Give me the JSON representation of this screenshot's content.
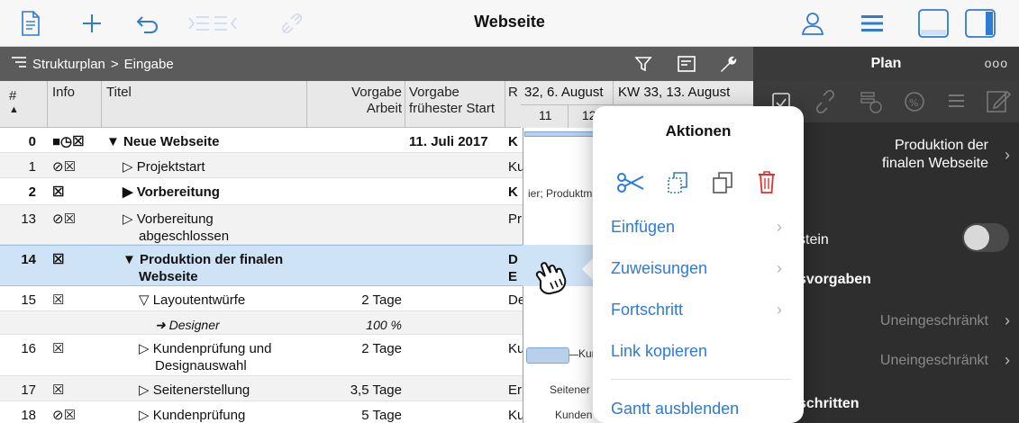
{
  "toolbar": {
    "title": "Webseite"
  },
  "breadcrumb": {
    "root": "Strukturplan",
    "separator": ">",
    "current": "Eingabe"
  },
  "inspector": {
    "title": "Plan",
    "more": "ooo",
    "task_name_line1": "Produktion der",
    "task_name_line2": "finalen Webseite",
    "milestone_label": "stein",
    "constraints_header": "svorgaben",
    "constraint_1": "Uneingeschränkt",
    "constraint_2": "Uneingeschränkt",
    "steps_header": "schritten",
    "milestone_enabled": false
  },
  "table": {
    "headers": {
      "num": "#",
      "info": "Info",
      "title": "Titel",
      "work_line1": "Vorgabe",
      "work_line2": "Arbeit",
      "start_line1": "Vorgabe",
      "start_line2": "frühester Start",
      "res": "R"
    },
    "rows": [
      {
        "num": "0",
        "info": "■◷☒",
        "title": "▼ Neue Webseite",
        "work": "",
        "start": "11. Juli 2017",
        "res": "K"
      },
      {
        "num": "1",
        "info": "⊘☒",
        "title": "▷ Projektstart",
        "work": "",
        "start": "",
        "res": "Ku"
      },
      {
        "num": "2",
        "info": "☒",
        "title": "▶ Vorbereitung",
        "work": "",
        "start": "",
        "res": "K"
      },
      {
        "num": "13",
        "info": "⊘☒",
        "title": "▷ Vorbereitung",
        "title2": "abgeschlossen",
        "work": "",
        "start": "",
        "res": "Pr"
      },
      {
        "num": "14",
        "info": "☒",
        "title": "▼ Produktion der finalen",
        "title2": "Webseite",
        "work": "",
        "start": "",
        "res": "D",
        "res2": "E"
      },
      {
        "num": "15",
        "info": "☒",
        "title": "▽ Layoutentwürfe",
        "work": "2 Tage",
        "start": "",
        "res": "De"
      },
      {
        "num": "",
        "info": "",
        "title": "➜ Designer",
        "work": "100 %",
        "start": "",
        "res": ""
      },
      {
        "num": "16",
        "info": "☒",
        "title": "▷ Kundenprüfung und",
        "title2": "Designauswahl",
        "work": "2 Tage",
        "start": "",
        "res": "Ku"
      },
      {
        "num": "17",
        "info": "☒",
        "title": "▷ Seitenerstellung",
        "work": "3,5 Tage",
        "start": "",
        "res": "Er"
      },
      {
        "num": "18",
        "info": "⊘☒",
        "title": "▷ Kundenprüfung",
        "work": "5 Tage",
        "start": "",
        "res": "Ku"
      }
    ]
  },
  "gantt": {
    "week1": "32, 6. August",
    "week2": "KW 33, 13. August",
    "day1": "11",
    "day2": "12",
    "bar_labels": {
      "row2": "ier; Produktma",
      "row16": "Kur",
      "row17": "Seitener",
      "row18": "Kunden"
    }
  },
  "popover": {
    "title": "Aktionen",
    "items": [
      "Einfügen",
      "Zuweisungen",
      "Fortschritt",
      "Link kopieren",
      "Gantt ausblenden"
    ]
  },
  "colors": {
    "accent": "#2f7ad3",
    "delete": "#e0302a",
    "selection": "#cfe3f7",
    "header_dark": "#5b5b5b",
    "inspector_bg": "#2e2e2e"
  }
}
